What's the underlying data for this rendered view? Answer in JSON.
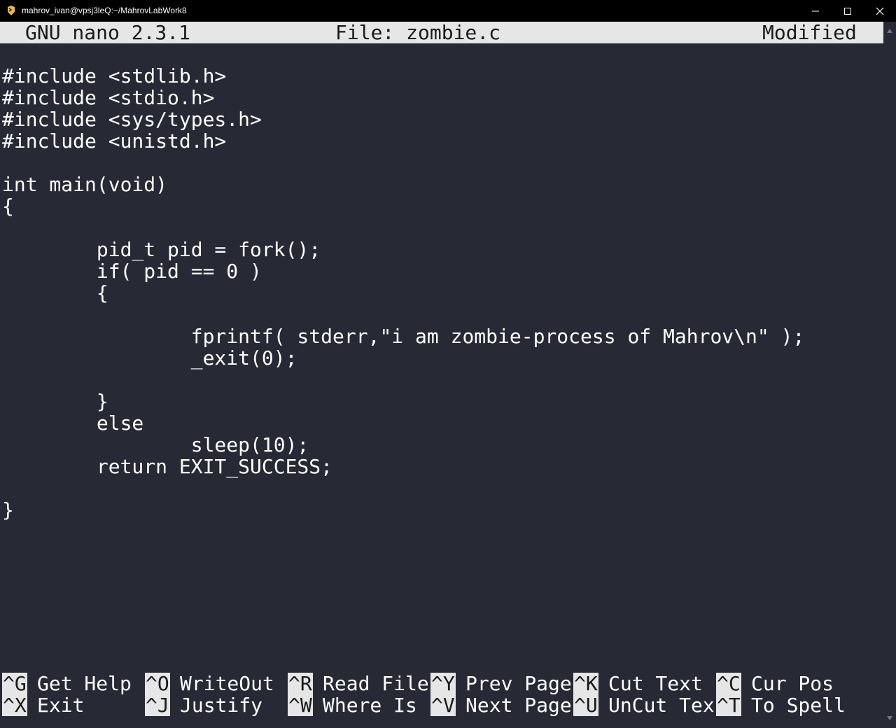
{
  "window": {
    "title": "mahrov_ivan@vpsj3leQ:~/MahrovLabWork8",
    "minimize_icon": "minimize-icon",
    "maximize_icon": "maximize-icon",
    "close_icon": "close-icon"
  },
  "nano_header": {
    "version": "GNU nano 2.3.1",
    "file": "File: zombie.c",
    "status": "Modified"
  },
  "code_lines": [
    "#include <stdlib.h>",
    "#include <stdio.h>",
    "#include <sys/types.h>",
    "#include <unistd.h>",
    "",
    "int main(void)",
    "{",
    "",
    "        pid_t pid = fork();",
    "        if( pid == 0 )",
    "        {",
    "",
    "                fprintf( stderr,\"i am zombie-process of Mahrov\\n\" );",
    "                _exit(0);",
    "",
    "        }",
    "        else",
    "                sleep(10);",
    "        return EXIT_SUCCESS;",
    "",
    "}"
  ],
  "shortcuts": {
    "row1": [
      {
        "key": "^G",
        "label": "Get Help"
      },
      {
        "key": "^O",
        "label": "WriteOut"
      },
      {
        "key": "^R",
        "label": "Read File"
      },
      {
        "key": "^Y",
        "label": "Prev Page"
      },
      {
        "key": "^K",
        "label": "Cut Text"
      },
      {
        "key": "^C",
        "label": "Cur Pos"
      }
    ],
    "row2": [
      {
        "key": "^X",
        "label": "Exit"
      },
      {
        "key": "^J",
        "label": "Justify"
      },
      {
        "key": "^W",
        "label": "Where Is"
      },
      {
        "key": "^V",
        "label": "Next Page"
      },
      {
        "key": "^U",
        "label": "UnCut Tex"
      },
      {
        "key": "^T",
        "label": "To Spell"
      }
    ]
  }
}
